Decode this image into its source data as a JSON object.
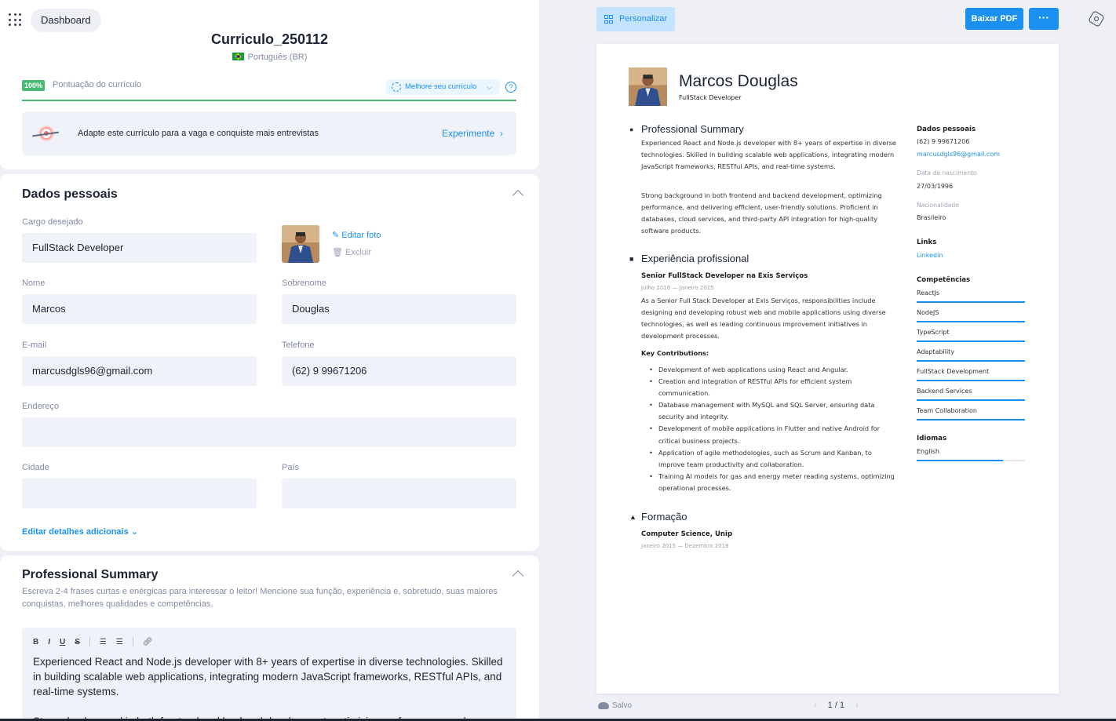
{
  "header": {
    "dashboard_label": "Dashboard",
    "doc_title": "Curriculo_250112",
    "language": "Português (BR)",
    "score_badge": "100%",
    "score_label": "Pontuação do currículo",
    "score_progress": 1.0,
    "improve_label": "Melhore seu currículo",
    "help_label": "?"
  },
  "promo": {
    "text": "Adapte este currículo para a vaga e conquiste mais entrevistas",
    "cta": "Experimente"
  },
  "personal": {
    "title": "Dados pessoais",
    "cargo_label": "Cargo desejado",
    "cargo_value": "FullStack Developer",
    "edit_photo": "Editar foto",
    "delete_photo": "Excluir",
    "nome_label": "Nome",
    "nome_value": "Marcos",
    "sobrenome_label": "Sobrenome",
    "sobrenome_value": "Douglas",
    "email_label": "E-mail",
    "email_value": "marcusdgls96@gmail.com",
    "telefone_label": "Telefone",
    "telefone_value": "(62) 9 99671206",
    "endereco_label": "Endereço",
    "endereco_value": "",
    "cidade_label": "Cidade",
    "cidade_value": "",
    "pais_label": "País",
    "pais_value": "",
    "add_details": "Editar detalhes adicionais"
  },
  "summary": {
    "title": "Professional Summary",
    "description": "Escreva 2-4 frases curtas e enérgicas para interessar o leitor! Mencione sua função, experiência e, sobretudo, suas maiores conquistas, melhores qualidades e competências.",
    "toolbar": {
      "bold": "B",
      "italic": "I",
      "underline": "U",
      "strike": "S"
    },
    "text1": "Experienced React and Node.js developer with 8+ years of expertise in diverse technologies. Skilled in building scalable web applications, integrating modern JavaScript frameworks, RESTful APIs, and real-time systems.",
    "text2": "Strong background in both frontend and backend development, optimizing performance, and"
  },
  "preview_toolbar": {
    "personalize": "Personalizar",
    "download_pdf": "Baixar PDF",
    "more": "···"
  },
  "cv": {
    "name": "Marcos Douglas",
    "role": "FullStack Developer",
    "summary_title": "Professional Summary",
    "summary_p1": "Experienced React and Node.js developer with 8+ years of expertise in diverse technologies. Skilled in building scalable web applications, integrating modern JavaScript frameworks, RESTful APIs, and real-time systems.",
    "summary_p2": "Strong background in both frontend and backend development, optimizing performance, and delivering efficient, user-friendly solutions. Proficient in databases, cloud services, and third-party API integration for high-quality software products.",
    "experience_title": "Experiência profissional",
    "job_title": "Senior FullStack Developer na Exis Serviços",
    "job_date": "Julho 2016 — Janeiro 2025",
    "job_desc": "As a Senior Full Stack Developer at Exis Serviços, responsibilities include designing and developing robust web and mobile applications using diverse technologies, as well as leading continuous improvement initiatives in development processes.",
    "key_contrib": "Key Contributions:",
    "bullets": [
      "Development of web applications using React and Angular.",
      "Creation and integration of RESTful APIs for efficient system communication.",
      "Database management with MySQL and SQL Server, ensuring data security and integrity.",
      "Development of mobile applications in Flutter and native Android for critical business projects.",
      "Application of agile methodologies, such as Scrum and Kanban, to improve team productivity and collaboration.",
      "Training AI models for gas and energy meter reading systems, optimizing operational processes."
    ],
    "education_title": "Formação",
    "edu_title": "Computer Science, Unip",
    "edu_date": "Janeiro 2015 — Dezembro 2018",
    "side": {
      "personal_title": "Dados pessoais",
      "phone": "(62) 9 99671206",
      "email": "marcusdgls96@gmail.com",
      "birth_label": "Data de nascimento",
      "birth_value": "27/03/1996",
      "nationality_label": "Nacionalidade",
      "nationality_value": "Brasileiro",
      "links_title": "Links",
      "linkedin": "Linkedin",
      "skills_title": "Competências",
      "skills": [
        {
          "name": "ReactJs",
          "level": 1.0
        },
        {
          "name": "NodeJS",
          "level": 1.0
        },
        {
          "name": "TypeScript",
          "level": 1.0
        },
        {
          "name": "Adaptability",
          "level": 1.0
        },
        {
          "name": "FullStack Development",
          "level": 1.0
        },
        {
          "name": "Backend Services",
          "level": 1.0
        },
        {
          "name": "Team Collaboration",
          "level": 1.0
        }
      ],
      "languages_title": "Idiomas",
      "languages": [
        {
          "name": "English",
          "level": 0.8
        }
      ]
    }
  },
  "footer": {
    "saved": "Salvo",
    "pages": "1 / 1"
  },
  "colors": {
    "accent": "#1a91f0",
    "success": "#48ba75",
    "field_bg": "#eff2f9"
  }
}
